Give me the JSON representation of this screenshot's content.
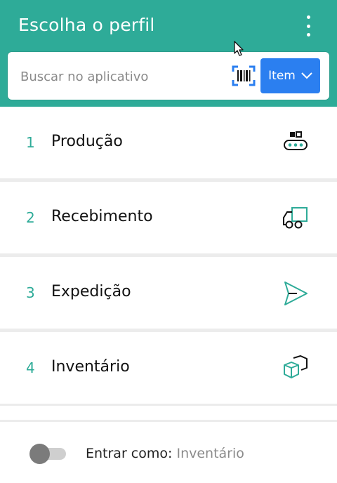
{
  "header": {
    "title": "Escolha o perfil",
    "menu_icon": "more-vertical-icon"
  },
  "search": {
    "placeholder": "Buscar no aplicativo",
    "value": "",
    "scan_icon": "barcode-scan-icon",
    "filter_label": "Item",
    "filter_icon": "chevron-down-icon"
  },
  "profiles": [
    {
      "number": "1",
      "label": "Produção",
      "icon": "conveyor-icon"
    },
    {
      "number": "2",
      "label": "Recebimento",
      "icon": "truck-icon"
    },
    {
      "number": "3",
      "label": "Expedição",
      "icon": "send-icon"
    },
    {
      "number": "4",
      "label": "Inventário",
      "icon": "boxes-icon"
    }
  ],
  "footer": {
    "toggle_checked": false,
    "prefix": "Entrar como:",
    "value": "Inventário"
  },
  "colors": {
    "header": "#2eab98",
    "accent_button": "#2b7ff0",
    "number": "#2eab98"
  }
}
